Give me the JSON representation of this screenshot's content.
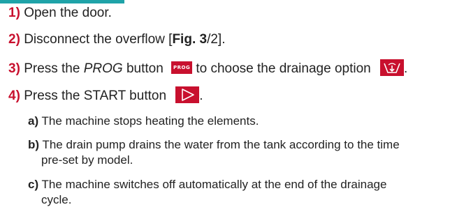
{
  "steps": [
    {
      "number": "1)",
      "text": "Open the door."
    },
    {
      "number": "2)",
      "text_before": "Disconnect the overflow [",
      "fig_label": "Fig. 3",
      "text_after": "/2]."
    },
    {
      "number": "3)",
      "text_before": "Press the ",
      "button_name": "PROG",
      "text_middle": " button ",
      "icon_label": "PROG",
      "text_after": " to choose the drainage option "
    },
    {
      "number": "4)",
      "text_before": "Press the START button ",
      "text_after": "."
    }
  ],
  "substeps": [
    {
      "letter": "a)",
      "text": "The machine stops heating the elements."
    },
    {
      "letter": "b)",
      "line1": "The drain pump drains the water from the tank according to the time",
      "line2": "pre-set by model."
    },
    {
      "letter": "c)",
      "line1": "The machine switches off automatically at the end of the drainage",
      "line2": "cycle."
    }
  ],
  "colors": {
    "accent_red": "#c8102e",
    "top_bar": "#1fa3a8"
  },
  "icons": {
    "prog": "prog-button-icon",
    "drain": "drain-icon",
    "start": "play-icon"
  }
}
